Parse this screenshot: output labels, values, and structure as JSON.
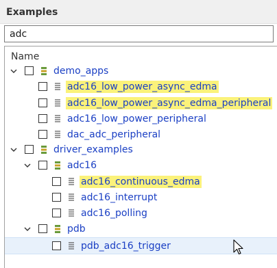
{
  "panel": {
    "title": "Examples"
  },
  "search": {
    "value": "adc"
  },
  "tree": {
    "column_header": "Name",
    "rows": [
      {
        "label": "demo_apps",
        "type": "folder",
        "expanded": true,
        "highlighted": false
      },
      {
        "label": "adc16_low_power_async_edma",
        "type": "file",
        "highlighted": true
      },
      {
        "label": "adc16_low_power_async_edma_peripheral",
        "type": "file",
        "highlighted": true
      },
      {
        "label": "adc16_low_power_peripheral",
        "type": "file",
        "highlighted": false
      },
      {
        "label": "dac_adc_peripheral",
        "type": "file",
        "highlighted": false
      },
      {
        "label": "driver_examples",
        "type": "folder",
        "expanded": true,
        "highlighted": false
      },
      {
        "label": "adc16",
        "type": "folder",
        "expanded": true,
        "highlighted": false
      },
      {
        "label": "adc16_continuous_edma",
        "type": "file",
        "highlighted": true
      },
      {
        "label": "adc16_interrupt",
        "type": "file",
        "highlighted": false
      },
      {
        "label": "adc16_polling",
        "type": "file",
        "highlighted": false
      },
      {
        "label": "pdb",
        "type": "folder",
        "expanded": true,
        "highlighted": false
      },
      {
        "label": "pdb_adc16_trigger",
        "type": "file",
        "highlighted": false,
        "selected": true
      }
    ]
  },
  "colors": {
    "link": "#1a3fc4",
    "highlight": "#fbf27a",
    "selection": "#e8f1fb",
    "folder_icon": "#6a9a3a"
  }
}
